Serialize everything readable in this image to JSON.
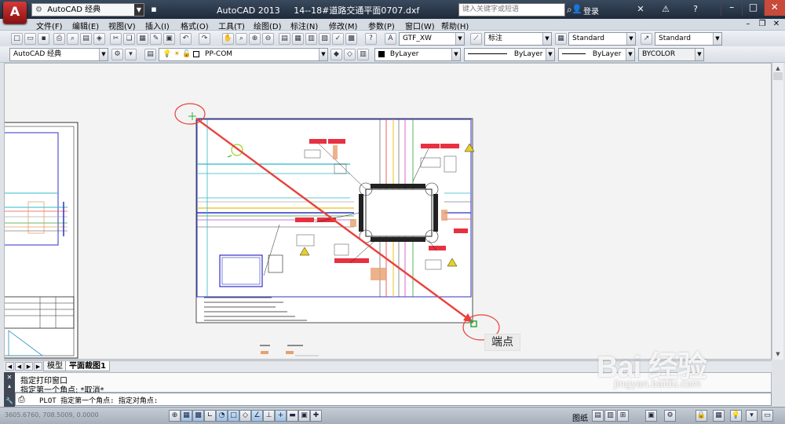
{
  "app": {
    "logo_letter": "A",
    "workspace": "AutoCAD 经典",
    "title": "AutoCAD 2013",
    "document": "14--18#道路交通平面0707.dxf",
    "search_placeholder": "键入关键字或短语",
    "login": "登录"
  },
  "menu": [
    "文件(F)",
    "编辑(E)",
    "视图(V)",
    "插入(I)",
    "格式(O)",
    "工具(T)",
    "绘图(D)",
    "标注(N)",
    "修改(M)",
    "参数(P)",
    "窗口(W)",
    "帮助(H)"
  ],
  "toolbar1": {
    "text_style": "GTF_XW",
    "dim_label": "标注",
    "dim_style": "Standard",
    "table_style": "Standard"
  },
  "toolbar2": {
    "workspace": "AutoCAD 经典",
    "layer": "PP-COM",
    "color": "ByLayer",
    "linetype": "ByLayer",
    "lineweight": "ByLayer",
    "plotstyle": "BYCOLOR"
  },
  "tabs": [
    "模型",
    "平面裁图1"
  ],
  "command": {
    "history": [
      "指定打印窗口",
      "指定第一个角点: *取消*"
    ],
    "current": "PLOT 指定第一个角点: 指定对角点:"
  },
  "status": {
    "coords": "3605.6760, 708.5009, 0.0000",
    "layout_label": "图纸"
  },
  "annotation": {
    "label": "端点",
    "color": "#e8413b"
  },
  "watermark": {
    "logo": "Bai 经验",
    "url": "jingyan.baidu.com"
  }
}
